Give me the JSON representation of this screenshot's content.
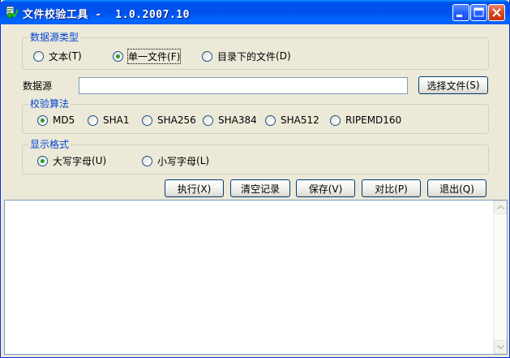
{
  "window": {
    "title": "文件校验工具 -  1.0.2007.10"
  },
  "source_type": {
    "title": "数据源类型",
    "options": [
      {
        "label": "文本",
        "accel": "(T)",
        "checked": false
      },
      {
        "label": "单一文件",
        "accel": "(F)",
        "checked": true
      },
      {
        "label": "目录下的文件",
        "accel": "(D)",
        "checked": false
      }
    ]
  },
  "source": {
    "label": "数据源",
    "value": "",
    "choose_button": "选择文件",
    "choose_accel": "(S)"
  },
  "algorithm": {
    "title": "校验算法",
    "options": [
      {
        "label": "MD5",
        "checked": true
      },
      {
        "label": "SHA1",
        "checked": false
      },
      {
        "label": "SHA256",
        "checked": false
      },
      {
        "label": "SHA384",
        "checked": false
      },
      {
        "label": "SHA512",
        "checked": false
      },
      {
        "label": "RIPEMD160",
        "checked": false
      }
    ]
  },
  "format": {
    "title": "显示格式",
    "options": [
      {
        "label": "大写字母",
        "accel": "(U)",
        "checked": true
      },
      {
        "label": "小写字母",
        "accel": "(L)",
        "checked": false
      }
    ]
  },
  "actions": {
    "execute": "执行(X)",
    "clear": "清空记录",
    "save": "保存(V)",
    "compare": "对比(P)",
    "exit": "退出(Q)"
  },
  "output": {
    "text": ""
  },
  "colors": {
    "titlebar": "#0054e3",
    "group_title": "#0046d5",
    "radio_check": "#21a121"
  }
}
